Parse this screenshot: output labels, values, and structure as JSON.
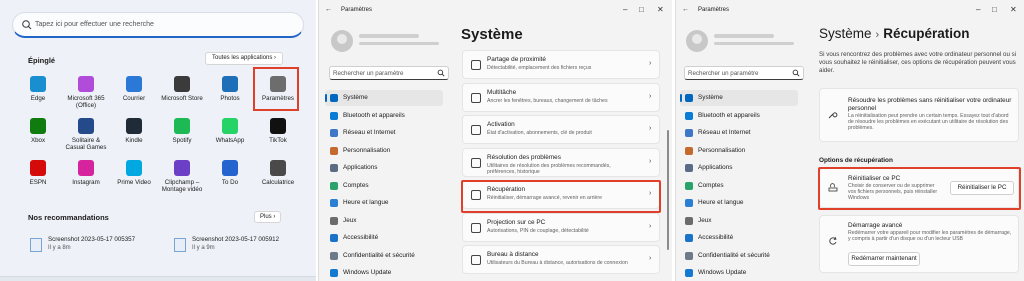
{
  "start_menu": {
    "search_placeholder": "Tapez ici pour effectuer une recherche",
    "pinned_title": "Épinglé",
    "all_apps_label": "Toutes les applications",
    "apps": [
      {
        "label": "Edge",
        "icon": "edge-icon",
        "color": "#1a8fd0"
      },
      {
        "label": "Microsoft 365 (Office)",
        "icon": "office-icon",
        "color": "#b04cd9"
      },
      {
        "label": "Courrier",
        "icon": "mail-icon",
        "color": "#2b79d6"
      },
      {
        "label": "Microsoft Store",
        "icon": "store-icon",
        "color": "#3b3b3b"
      },
      {
        "label": "Photos",
        "icon": "photos-icon",
        "color": "#1d6fb8"
      },
      {
        "label": "Paramètres",
        "icon": "gear-icon",
        "color": "#6d6d6d"
      },
      {
        "label": "Xbox",
        "icon": "xbox-icon",
        "color": "#107c10"
      },
      {
        "label": "Solitaire & Casual Games",
        "icon": "cards-icon",
        "color": "#244a8a"
      },
      {
        "label": "Kindle",
        "icon": "kindle-icon",
        "color": "#1f2b37"
      },
      {
        "label": "Spotify",
        "icon": "spotify-icon",
        "color": "#1db954"
      },
      {
        "label": "WhatsApp",
        "icon": "whatsapp-icon",
        "color": "#25d366"
      },
      {
        "label": "TikTok",
        "icon": "tiktok-icon",
        "color": "#111111"
      },
      {
        "label": "ESPN",
        "icon": "espn-icon",
        "color": "#d50a0a"
      },
      {
        "label": "Instagram",
        "icon": "instagram-icon",
        "color": "#d6249f"
      },
      {
        "label": "Prime Video",
        "icon": "prime-video-icon",
        "color": "#00a8e1"
      },
      {
        "label": "Clipchamp – Montage vidéo",
        "icon": "clipchamp-icon",
        "color": "#6b3fc6"
      },
      {
        "label": "To Do",
        "icon": "todo-icon",
        "color": "#2564cf"
      },
      {
        "label": "Calculatrice",
        "icon": "calculator-icon",
        "color": "#4a4a4a"
      }
    ],
    "recs_title": "Nos recommandations",
    "plus_label": "Plus",
    "recs": [
      {
        "name": "Screenshot 2023-05-17 005357",
        "time": "Il y a 8m"
      },
      {
        "name": "Screenshot 2023-05-17 005912",
        "time": "Il y a 9m"
      }
    ]
  },
  "settings": {
    "window_title": "Paramètres",
    "search_placeholder": "Rechercher un paramètre",
    "nav": [
      {
        "label": "Système",
        "icon": "system-icon",
        "color": "#0067c0"
      },
      {
        "label": "Bluetooth et appareils",
        "icon": "bluetooth-icon",
        "color": "#0a7cd6"
      },
      {
        "label": "Réseau et Internet",
        "icon": "wifi-icon",
        "color": "#3d77c7"
      },
      {
        "label": "Personnalisation",
        "icon": "brush-icon",
        "color": "#c46a2e"
      },
      {
        "label": "Applications",
        "icon": "apps-icon",
        "color": "#5a6b86"
      },
      {
        "label": "Comptes",
        "icon": "account-icon",
        "color": "#2aa36b"
      },
      {
        "label": "Heure et langue",
        "icon": "clock-globe-icon",
        "color": "#2a7fd4"
      },
      {
        "label": "Jeux",
        "icon": "controller-icon",
        "color": "#6b6b6b"
      },
      {
        "label": "Accessibilité",
        "icon": "accessibility-icon",
        "color": "#1a73c9"
      },
      {
        "label": "Confidentialité et sécurité",
        "icon": "shield-icon",
        "color": "#6e7a8a"
      },
      {
        "label": "Windows Update",
        "icon": "update-icon",
        "color": "#1479d0"
      }
    ]
  },
  "system_page": {
    "title": "Système",
    "items": [
      {
        "title": "Partage de proximité",
        "sub": "Détectabilité, emplacement des fichiers reçus",
        "icon": "share-icon"
      },
      {
        "title": "Multitâche",
        "sub": "Ancrer les fenêtres, bureaux, changement de tâches",
        "icon": "multitask-icon"
      },
      {
        "title": "Activation",
        "sub": "État d'activation, abonnements, clé de produit",
        "icon": "activation-icon"
      },
      {
        "title": "Résolution des problèmes",
        "sub": "Utilitaires de résolution des problèmes recommandés, préférences, historique",
        "icon": "wrench-icon"
      },
      {
        "title": "Récupération",
        "sub": "Réinitialiser, démarrage avancé, revenir en arrière",
        "icon": "recovery-icon"
      },
      {
        "title": "Projection sur ce PC",
        "sub": "Autorisations, PIN de couplage, détectabilité",
        "icon": "projection-icon"
      },
      {
        "title": "Bureau à distance",
        "sub": "Utilisateurs du Bureau à distance, autorisations de connexion",
        "icon": "remote-desktop-icon"
      }
    ]
  },
  "recovery_page": {
    "breadcrumb_parent": "Système",
    "breadcrumb_sep": "›",
    "breadcrumb_current": "Récupération",
    "intro": "Si vous rencontrez des problèmes avec votre ordinateur personnel ou si vous souhaitez le réinitialiser, ces options de récupération peuvent vous aider.",
    "fix": {
      "title": "Résoudre les problèmes sans réinitialiser votre ordinateur personnel",
      "sub": "La réinitialisation peut prendre un certain temps. Essayez tout d'abord de résoudre les problèmes en exécutant un utilitaire de résolution des problèmes."
    },
    "section_title": "Options de récupération",
    "reset": {
      "title": "Réinitialiser ce PC",
      "sub": "Choisir de conserver ou de supprimer vos fichiers personnels, puis réinstaller Windows",
      "button": "Réinitialiser le PC"
    },
    "advanced": {
      "title": "Démarrage avancé",
      "sub": "Redémarrer votre appareil pour modifier les paramètres de démarrage, y compris à partir d'un disque ou d'un lecteur USB",
      "button": "Redémarrer maintenant"
    }
  },
  "accent": "#0067c0",
  "highlight": "#e0402a"
}
